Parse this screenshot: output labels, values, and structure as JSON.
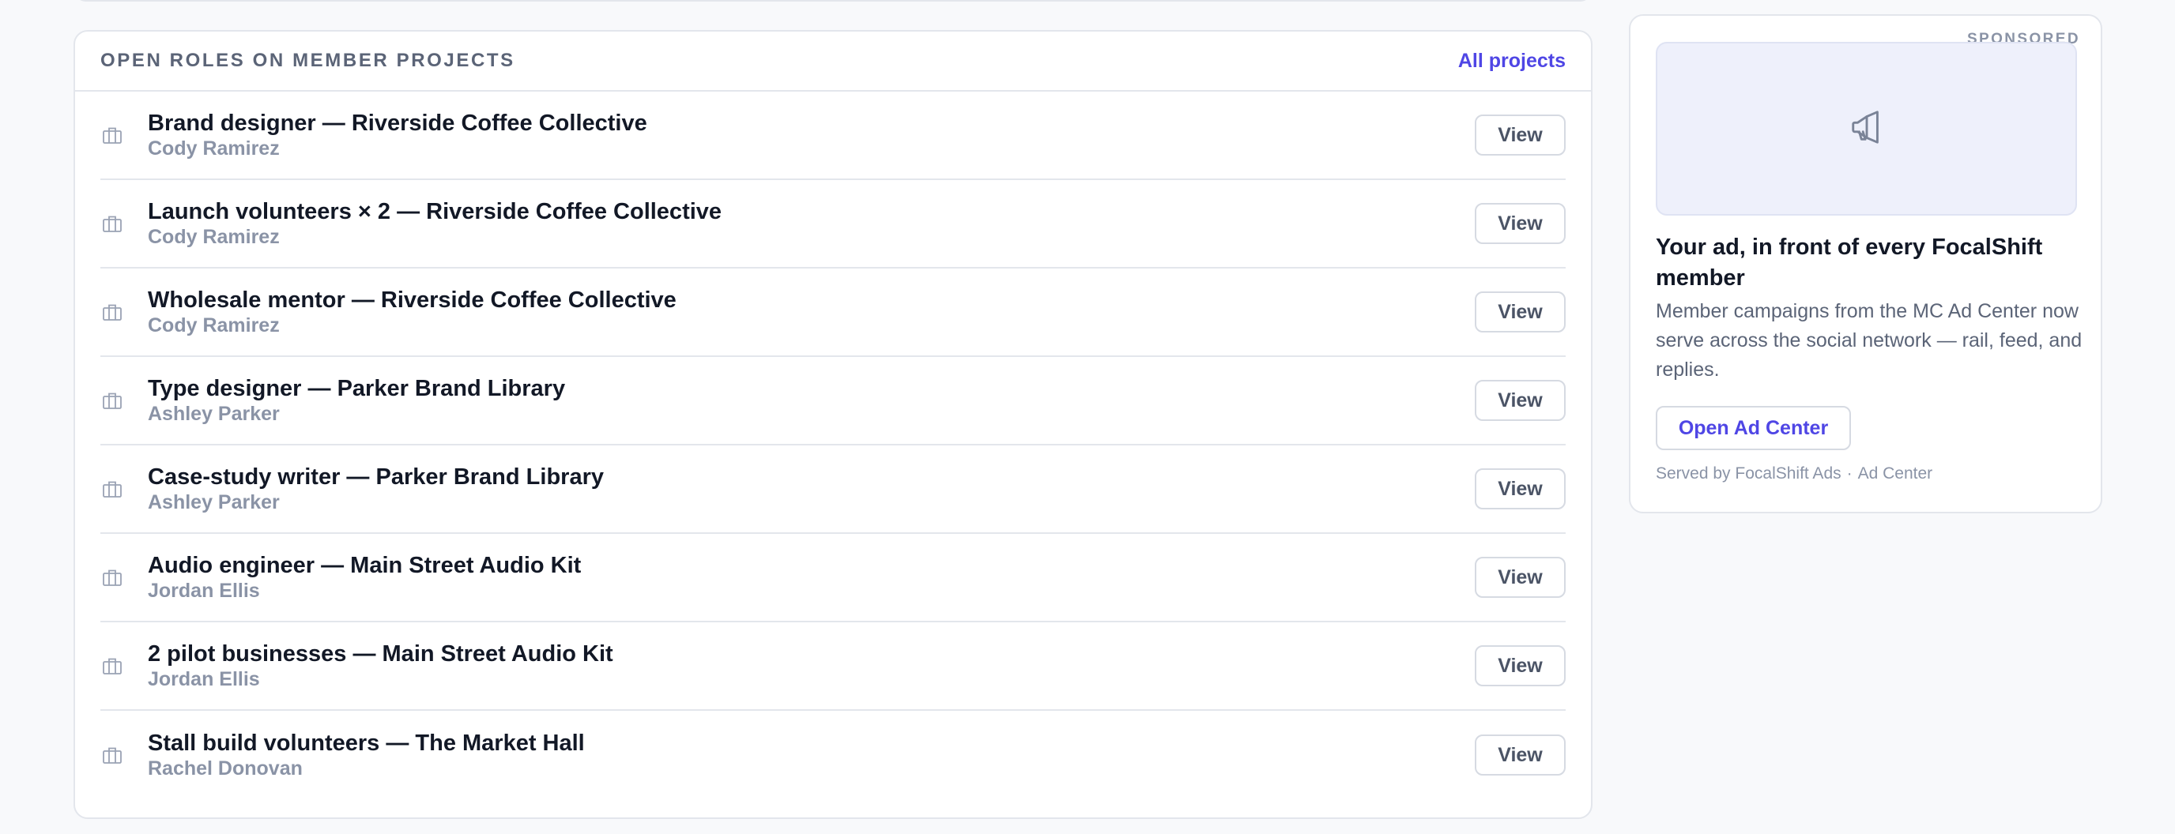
{
  "roles_card": {
    "title": "OPEN ROLES ON MEMBER PROJECTS",
    "all_link": "All projects",
    "view_label": "View",
    "row_icon": "briefcase-icon",
    "roles": [
      {
        "title": "Brand designer — Riverside Coffee Collective",
        "owner": "Cody Ramirez"
      },
      {
        "title": "Launch volunteers × 2 — Riverside Coffee Collective",
        "owner": "Cody Ramirez"
      },
      {
        "title": "Wholesale mentor — Riverside Coffee Collective",
        "owner": "Cody Ramirez"
      },
      {
        "title": "Type designer — Parker Brand Library",
        "owner": "Ashley Parker"
      },
      {
        "title": "Case-study writer — Parker Brand Library",
        "owner": "Ashley Parker"
      },
      {
        "title": "Audio engineer — Main Street Audio Kit",
        "owner": "Jordan Ellis"
      },
      {
        "title": "2 pilot businesses — Main Street Audio Kit",
        "owner": "Jordan Ellis"
      },
      {
        "title": "Stall build volunteers — The Market Hall",
        "owner": "Rachel Donovan"
      }
    ]
  },
  "ad": {
    "badge": "SPONSORED",
    "image_icon": "megaphone-icon",
    "headline": "Your ad, in front of every FocalShift member",
    "body": "Member campaigns from the MC Ad Center now serve across the social network — rail, feed, and replies.",
    "cta": "Open Ad Center",
    "footer_left": "Served by FocalShift Ads",
    "footer_sep": "·",
    "footer_right": "Ad Center"
  },
  "colors": {
    "accent": "#4f46e5",
    "muted": "#8a93a6",
    "border": "#e3e6ec",
    "page_bg": "#f8f9fb"
  }
}
